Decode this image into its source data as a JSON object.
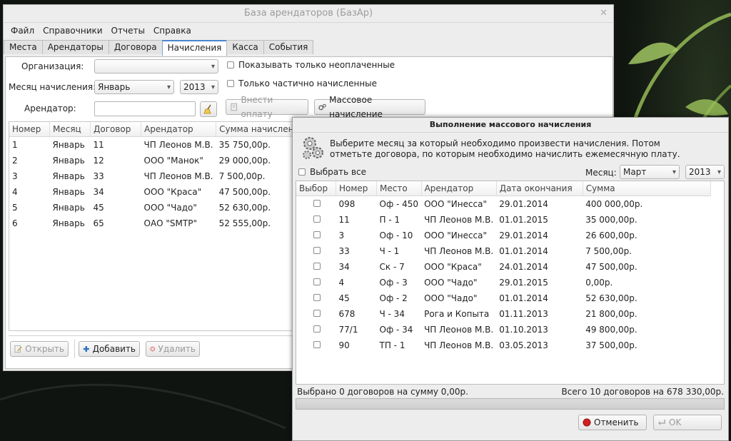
{
  "main": {
    "title": "База арендаторов (БазАр)",
    "menu": [
      "Файл",
      "Справочники",
      "Отчеты",
      "Справка"
    ],
    "tabs": [
      "Места",
      "Арендаторы",
      "Договора",
      "Начисления",
      "Касса",
      "События"
    ],
    "active_tab": "Начисления",
    "form": {
      "org_label": "Организация:",
      "org_value": "",
      "month_label": "Месяц начисления:",
      "month_value": "Январь",
      "year_value": "2013",
      "tenant_label": "Арендатор:",
      "tenant_value": "",
      "only_unpaid": "Показывать только неоплаченные",
      "only_partial": "Только частично начисленные",
      "pay_button": "Внести оплату",
      "mass_button": "Массовое начисление"
    },
    "table": {
      "headers": [
        "Номер",
        "Месяц",
        "Договор",
        "Арендатор",
        "Сумма начислен"
      ],
      "rows": [
        [
          "1",
          "Январь",
          "11",
          "ЧП Леонов М.В.",
          "35 750,00р."
        ],
        [
          "2",
          "Январь",
          "12",
          "ООО \"Манок\"",
          "29 000,00р."
        ],
        [
          "3",
          "Январь",
          "33",
          "ЧП Леонов М.В.",
          "7 500,00р."
        ],
        [
          "4",
          "Январь",
          "34",
          "ООО \"Краса\"",
          "47 500,00р."
        ],
        [
          "5",
          "Январь",
          "45",
          "ООО \"Чадо\"",
          "52 630,00р."
        ],
        [
          "6",
          "Январь",
          "65",
          "ОАО \"SMTP\"",
          "52 555,00р."
        ]
      ]
    },
    "buttons": {
      "open": "Открыть",
      "add": "Добавить",
      "delete": "Удалить"
    }
  },
  "dialog": {
    "title": "Выполнение массового начисления",
    "info_line1": "Выберите месяц за который необходимо произвести начисления. Потом",
    "info_line2": "отметьте договора, по которым необходимо начислить ежемесячную плату.",
    "select_all": "Выбрать все",
    "month_label": "Месяц:",
    "month_value": "Март",
    "year_value": "2013",
    "headers": [
      "Выбор",
      "Номер",
      "Место",
      "Арендатор",
      "Дата окончания",
      "Сумма"
    ],
    "rows": [
      [
        "098",
        "Оф - 450",
        "ООО \"Инесса\"",
        "29.01.2014",
        "400 000,00р."
      ],
      [
        "11",
        "П - 1",
        "ЧП Леонов М.В.",
        "01.01.2015",
        "35 000,00р."
      ],
      [
        "3",
        "Оф - 10",
        "ООО \"Инесса\"",
        "29.01.2014",
        "26 600,00р."
      ],
      [
        "33",
        "Ч - 1",
        "ЧП Леонов М.В.",
        "01.01.2014",
        "7 500,00р."
      ],
      [
        "34",
        "Ск - 7",
        "ООО \"Краса\"",
        "24.01.2014",
        "47 500,00р."
      ],
      [
        "4",
        "Оф - 3",
        "ООО \"Чадо\"",
        "29.01.2015",
        "0,00р."
      ],
      [
        "45",
        "Оф - 2",
        "ООО \"Чадо\"",
        "01.01.2014",
        "52 630,00р."
      ],
      [
        "678",
        "Ч - 34",
        "Рога и Копыта",
        "01.11.2013",
        "21 800,00р."
      ],
      [
        "77/1",
        "Оф - 34",
        "ЧП Леонов М.В.",
        "01.10.2013",
        "49 800,00р."
      ],
      [
        "90",
        "ТП - 1",
        "ЧП Леонов М.В.",
        "03.05.2013",
        "37 500,00р."
      ]
    ],
    "status_selected": "Выбрано 0 договоров на сумму 0,00р.",
    "status_total": "Всего 10 договоров на 678 330,00р.",
    "cancel": "Отменить",
    "ok": "OK"
  },
  "colors": {
    "accent": "#4a86cf",
    "cancel_icon": "#d42020",
    "add_icon": "#2f6fc0"
  }
}
